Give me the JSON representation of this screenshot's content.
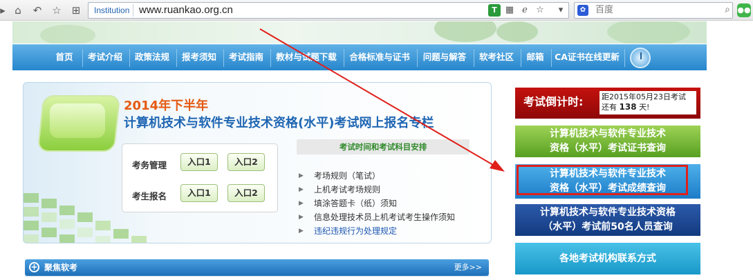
{
  "browser": {
    "url_badge": "Institution",
    "url": "www.ruankao.org.cn",
    "search_placeholder": "百度",
    "search_engine_logo": "baidu-paw-icon",
    "toolbar_icons": [
      "home-icon",
      "undo-icon",
      "star-icon",
      "tabs-icon"
    ]
  },
  "nav": {
    "items": [
      "首页",
      "考试介绍",
      "政策法规",
      "报考须知",
      "考试指南",
      "教材与试题下载",
      "合格标准与证书",
      "问题与解答",
      "软考社区",
      "邮箱",
      "CA证书在线更新"
    ]
  },
  "main": {
    "year_title": "2014年下半年",
    "title": "计算机技术与软件专业技术资格(水平)考试网上报名专栏",
    "exam_admin_label": "考务管理",
    "candidate_label": "考生报名",
    "entry1": "入口1",
    "entry2": "入口2",
    "schedule_label": "考试时间和考试科目安排",
    "links": [
      "考场规则（笔试）",
      "上机考试考场规则",
      "填涂答题卡（纸）须知",
      "信息处理技术员上机考试考生操作须知",
      "违纪违规行为处理规定"
    ]
  },
  "news": {
    "title": "聚焦软考",
    "more": "更多>>"
  },
  "sidebar": {
    "countdown_title": "考试倒计时:",
    "countdown_line1": "距2015年05月23日考试",
    "countdown_prefix": "还有",
    "countdown_days": "138",
    "countdown_suffix": "天!",
    "certificate_query_line1": "计算机技术与软件专业技术",
    "certificate_query_line2": "资格（水平）考试证书查询",
    "score_query_line1": "计算机技术与软件专业技术",
    "score_query_line2": "资格（水平）考试成绩查询",
    "top50_query_line1": "计算机技术与软件专业技术资格",
    "top50_query_line2": "（水平）考试前50名人员查询",
    "contacts": "各地考试机构联系方式"
  },
  "colors": {
    "nav": "#2786cc",
    "annotation_red": "#e0201b",
    "title_orange": "#e55a12",
    "title_blue": "#1f66b3"
  }
}
